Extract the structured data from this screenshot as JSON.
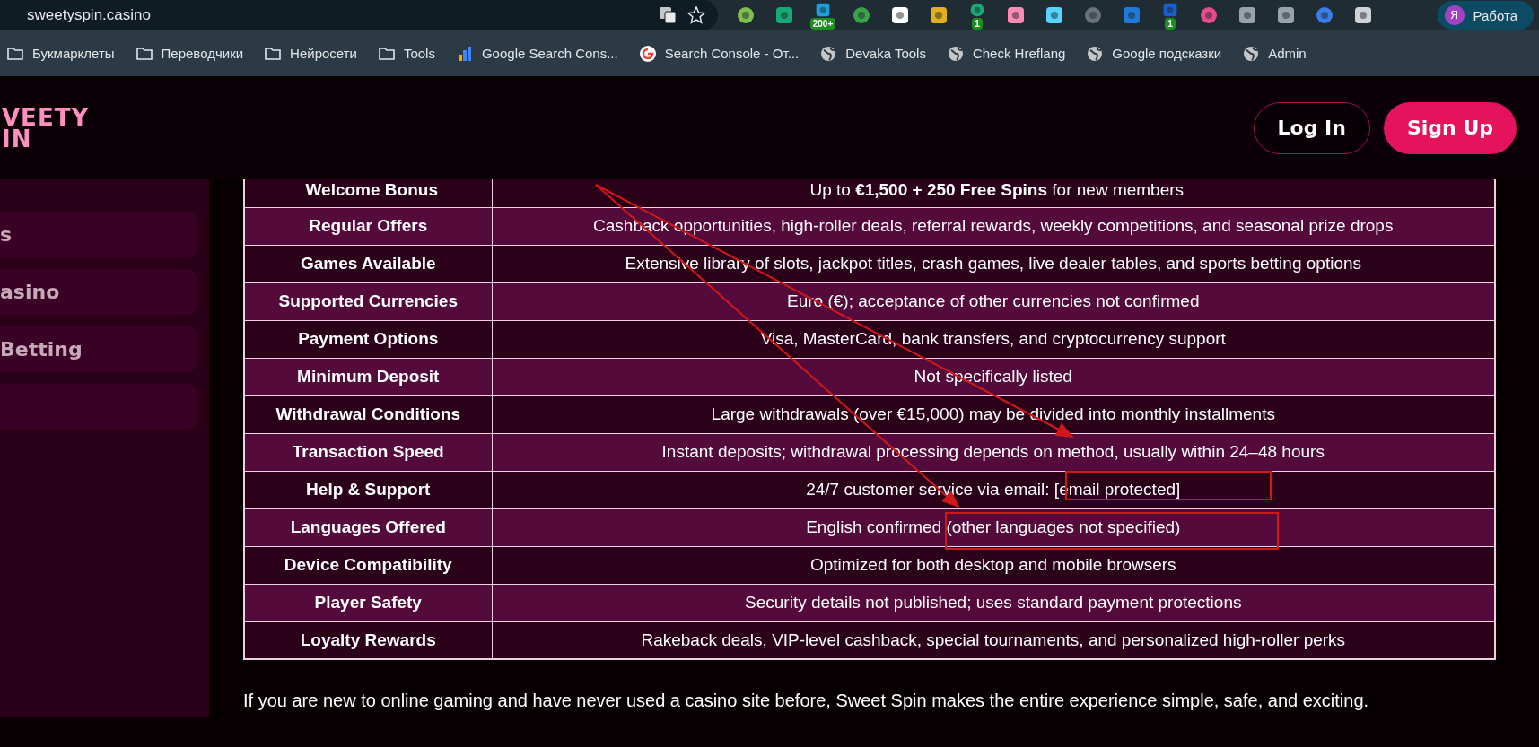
{
  "browser": {
    "url": "sweetyspin.casino",
    "extensions": [
      {
        "kind": "extension"
      },
      {
        "kind": "extension"
      },
      {
        "kind": "extension",
        "badge": "200+"
      },
      {
        "kind": "extension"
      },
      {
        "kind": "extension"
      },
      {
        "kind": "extension"
      },
      {
        "kind": "extension",
        "badge": "1"
      },
      {
        "kind": "extension"
      },
      {
        "kind": "extension"
      },
      {
        "kind": "extension"
      },
      {
        "kind": "extension"
      },
      {
        "kind": "extension",
        "badge": "1"
      },
      {
        "kind": "extension"
      },
      {
        "kind": "extension"
      },
      {
        "kind": "extension"
      },
      {
        "kind": "extension"
      },
      {
        "kind": "extension"
      }
    ],
    "profile": {
      "initial": "Я",
      "label": "Работа"
    },
    "bookmarks": [
      {
        "kind": "folder",
        "label": "Букмарклеты"
      },
      {
        "kind": "folder",
        "label": "Переводчики"
      },
      {
        "kind": "folder",
        "label": "Нейросети"
      },
      {
        "kind": "folder",
        "label": "Tools"
      },
      {
        "kind": "chart",
        "label": "Google Search Cons..."
      },
      {
        "kind": "google",
        "label": "Search Console - От..."
      },
      {
        "kind": "globe",
        "label": "Devaka Tools"
      },
      {
        "kind": "globe",
        "label": "Check Hreflang"
      },
      {
        "kind": "globe",
        "label": "Google подсказки"
      },
      {
        "kind": "globe",
        "label": "Admin"
      }
    ]
  },
  "header": {
    "logo_lines": [
      "VEETY",
      "IN"
    ],
    "buttons": [
      {
        "kind": "outline",
        "label": "Log In"
      },
      {
        "kind": "filled",
        "label": "Sign Up"
      }
    ]
  },
  "sidebar": {
    "items": [
      {
        "kind": "text",
        "label": "s"
      },
      {
        "kind": "text",
        "label": "asino"
      },
      {
        "kind": "text",
        "label": "Betting"
      },
      {
        "kind": "blank"
      }
    ]
  },
  "table": {
    "rows": [
      {
        "label": "Welcome Bonus",
        "value": "Up to **€1,500 + 250 Free Spins** for new members"
      },
      {
        "label": "Regular Offers",
        "value": "Cashback opportunities, high-roller deals, referral rewards, weekly competitions, and seasonal prize drops"
      },
      {
        "label": "Games Available",
        "value": "Extensive library of slots, jackpot titles, crash games, live dealer tables, and sports betting options"
      },
      {
        "label": "Supported Currencies",
        "value": "Euro (€); acceptance of other currencies not confirmed"
      },
      {
        "label": "Payment Options",
        "value": "Visa, MasterCard, bank transfers, and cryptocurrency support"
      },
      {
        "label": "Minimum Deposit",
        "value": "Not specifically listed"
      },
      {
        "label": "Withdrawal Conditions",
        "value": "Large withdrawals (over €15,000) may be divided into monthly installments"
      },
      {
        "label": "Transaction Speed",
        "value": "Instant deposits; withdrawal processing depends on method, usually within 24–48 hours"
      },
      {
        "label": "Help & Support",
        "value": "24/7 customer service via email: [email protected]"
      },
      {
        "label": "Languages Offered",
        "value": "English confirmed (other languages not specified)"
      },
      {
        "label": "Device Compatibility",
        "value": "Optimized for both desktop and mobile browsers"
      },
      {
        "label": "Player Safety",
        "value": "Security details not published; uses standard payment protections"
      },
      {
        "label": "Loyalty Rewards",
        "value": "Rakeback deals, VIP-level cashback, special tournaments, and personalized high-roller perks"
      }
    ]
  },
  "intro": "If you are new to online gaming and have never used a casino site before, Sweet Spin makes the entire experience simple, safe, and exciting."
}
